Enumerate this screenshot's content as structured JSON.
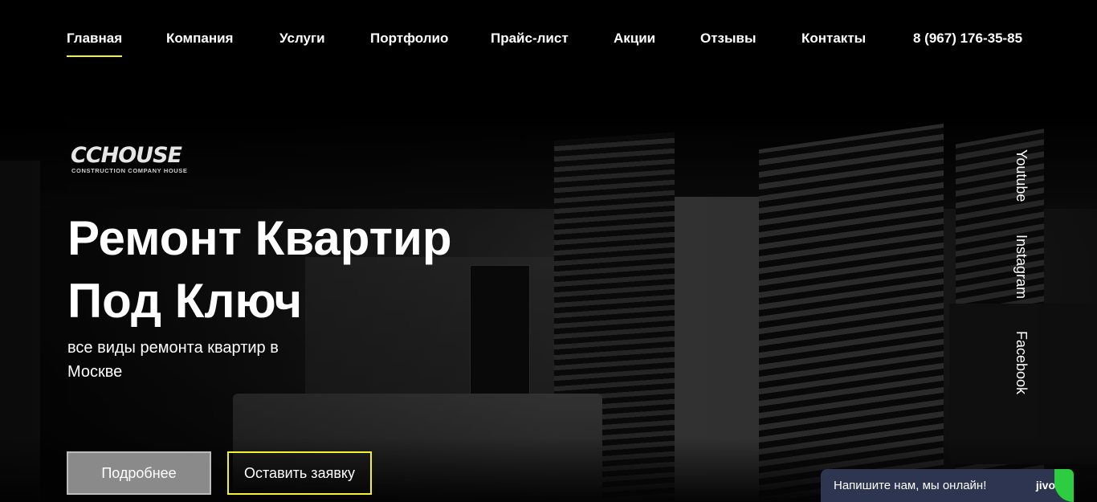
{
  "nav": {
    "items": [
      {
        "label": "Главная",
        "active": true
      },
      {
        "label": "Компания",
        "active": false
      },
      {
        "label": "Услуги",
        "active": false
      },
      {
        "label": "Портфолио",
        "active": false
      },
      {
        "label": "Прайс-лист",
        "active": false
      },
      {
        "label": "Акции",
        "active": false
      },
      {
        "label": "Отзывы",
        "active": false
      },
      {
        "label": "Контакты",
        "active": false
      }
    ],
    "phone": "8 (967) 176-35-85",
    "accent_color": "#f4f22a"
  },
  "logo": {
    "brand": "CCHOUSE",
    "tagline": "CONSTRUCTION COMPANY HOUSE"
  },
  "hero": {
    "title_line1": "Ремонт Квартир",
    "title_line2": "Под Ключ",
    "subtitle": "все виды ремонта квартир в Москве"
  },
  "buttons": {
    "more": "Подробнее",
    "request": "Оставить заявку"
  },
  "social": [
    "Youtube",
    "Instagram",
    "Facebook"
  ],
  "chat": {
    "message": "Напишите нам, мы онлайн!",
    "brand": "jivo",
    "color": "#2d3550"
  }
}
